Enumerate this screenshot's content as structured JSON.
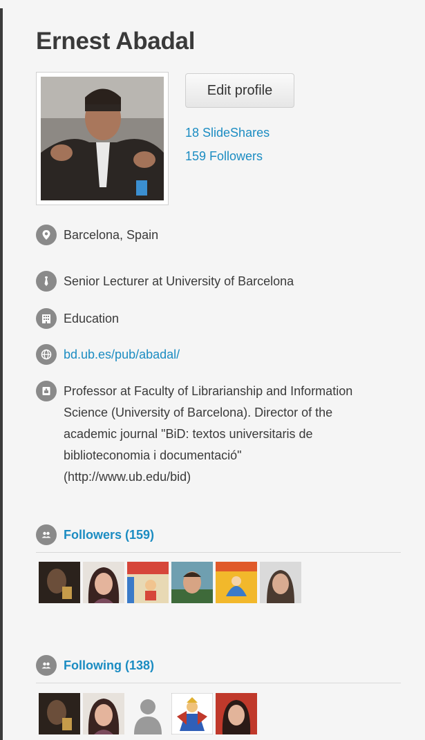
{
  "profile": {
    "name": "Ernest Abadal",
    "edit_label": "Edit profile",
    "slideshares_label": "18 SlideShares",
    "followers_label": "159 Followers"
  },
  "info": {
    "location": "Barcelona, Spain",
    "job": "Senior Lecturer at University of Barcelona",
    "industry": "Education",
    "website": "bd.ub.es/pub/abadal/",
    "summary": "Professor at Faculty of Librarianship and Information Science (University of Barcelona). Director of the academic journal \"BiD: textos universitaris de biblioteconomia i documentació\" (http://www.ub.edu/bid)"
  },
  "followers_section": {
    "title": "Followers (159)"
  },
  "following_section": {
    "title": "Following (138)"
  },
  "colors": {
    "link": "#1b8cc2",
    "text": "#3a3a3a",
    "icon_bg": "#8a8a8a",
    "background": "#f5f5f5"
  },
  "icons": {
    "location": "map-pin-icon",
    "job": "tie-icon",
    "industry": "building-icon",
    "website": "globe-icon",
    "summary": "id-card-icon",
    "people": "people-icon"
  }
}
